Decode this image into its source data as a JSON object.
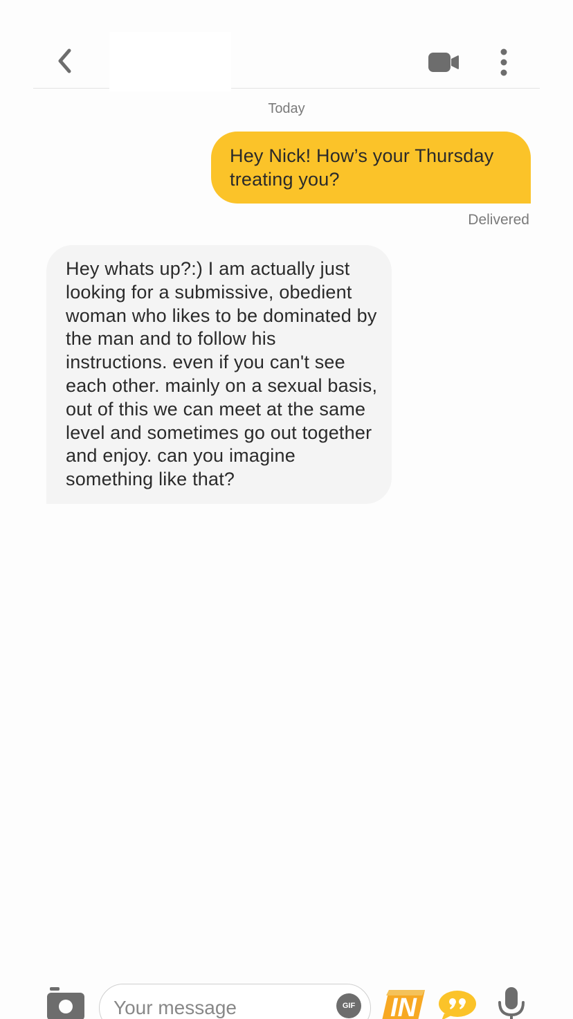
{
  "header": {
    "back_icon": "chevron-left-icon",
    "video_icon": "video-camera-icon",
    "more_icon": "more-vertical-icon"
  },
  "conversation": {
    "date_label": "Today",
    "messages": [
      {
        "direction": "outgoing",
        "text": "Hey Nick! How’s your Thursday treating you?",
        "status": "Delivered"
      },
      {
        "direction": "incoming",
        "text": "Hey whats up?:) I am actually just looking for a submissive, obedient woman who likes to be dominated by the man and to follow his instructions. even if you can't see each other. mainly on a sexual basis, out of this we can meet at the same level and sometimes go out together and enjoy. can you imagine something like that?"
      }
    ]
  },
  "composer": {
    "placeholder": "Your message",
    "gif_label": "GIF",
    "opener_label": "IN",
    "camera_icon": "camera-icon",
    "quote_icon": "quote-icon",
    "mic_icon": "microphone-icon"
  },
  "colors": {
    "accent": "#fbc329",
    "incoming_bubble": "#f4f4f4",
    "icon_gray": "#6d6d6d"
  }
}
